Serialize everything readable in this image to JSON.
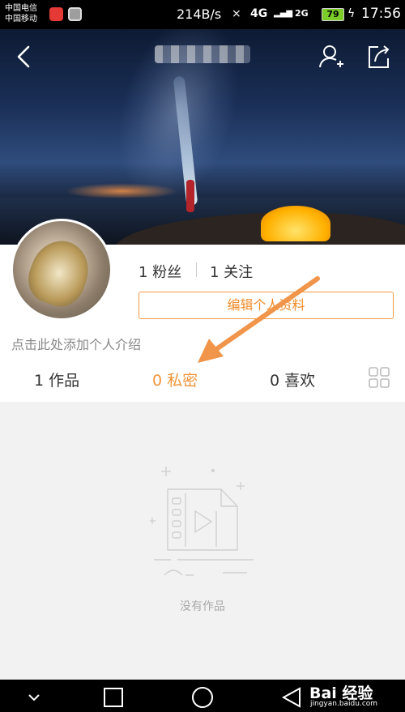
{
  "status_bar": {
    "carrier_1": "中国电信",
    "carrier_2": "中国移动",
    "net_speed": "214B/s",
    "network_1": "4G",
    "network_2": "2G",
    "battery": "79",
    "time": "17:56"
  },
  "profile": {
    "followers": "1 粉丝",
    "following": "1 关注",
    "edit_button": "编辑个人资料",
    "intro_placeholder": "点击此处添加个人介绍"
  },
  "tabs": {
    "works": "1 作品",
    "private": "0 私密",
    "likes": "0 喜欢"
  },
  "empty_state": {
    "text": "没有作品"
  },
  "watermark": {
    "brand": "Bai 经验",
    "url": "jingyan.baidu.com"
  },
  "colors": {
    "accent": "#f0953a",
    "annotation_arrow": "#f0954a"
  }
}
